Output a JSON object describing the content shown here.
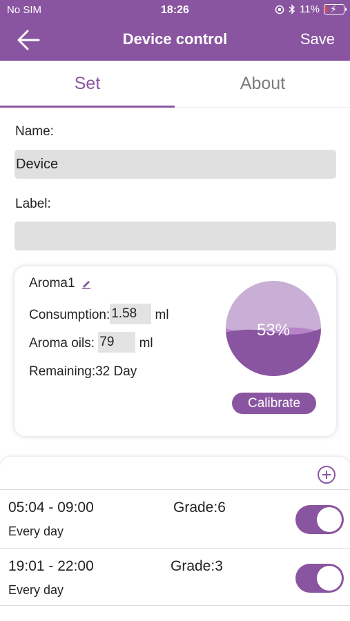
{
  "status_bar": {
    "carrier": "No SIM",
    "time": "18:26",
    "battery": "11%",
    "battery_level": 0.11
  },
  "navbar": {
    "title": "Device control",
    "save_label": "Save"
  },
  "tabs": [
    {
      "label": "Set",
      "active": true
    },
    {
      "label": "About",
      "active": false
    }
  ],
  "form": {
    "name_label": "Name:",
    "name_value": "Device",
    "label_label": "Label:",
    "label_value": ""
  },
  "aroma": {
    "name": "Aroma1",
    "consumption_label": "Consumption:",
    "consumption_value": "1.58",
    "consumption_unit": "ml",
    "oils_label": "Aroma oils:",
    "oils_value": "79",
    "oils_unit": "ml",
    "remaining_label": "Remaining:",
    "remaining_value": "32 Day",
    "level_percent": "53%",
    "level_fraction": 0.53,
    "calibrate_label": "Calibrate"
  },
  "schedules": [
    {
      "time": "05:04 - 09:00",
      "grade": "Grade:6",
      "repeat": "Every day",
      "enabled": true
    },
    {
      "time": "19:01 - 22:00",
      "grade": "Grade:3",
      "repeat": "Every day",
      "enabled": true
    }
  ],
  "colors": {
    "accent": "#8a55a0",
    "gauge_light": "#c9aed6",
    "field_bg": "#e0e0e0"
  }
}
